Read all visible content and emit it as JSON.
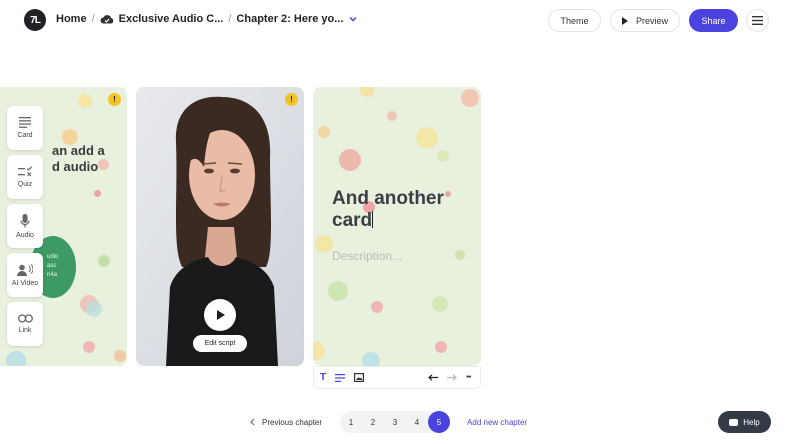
{
  "header": {
    "logo_text": "7L",
    "breadcrumbs": [
      "Home",
      "Exclusive Audio C...",
      "Chapter 2: Here yo..."
    ],
    "theme_label": "Theme",
    "preview_label": "Preview",
    "share_label": "Share",
    "accent_color": "#4a43e0"
  },
  "tools": [
    {
      "label": "Card",
      "icon": "card-icon"
    },
    {
      "label": "Quiz",
      "icon": "quiz-icon"
    },
    {
      "label": "Audio",
      "icon": "microphone-icon"
    },
    {
      "label": "AI Video",
      "icon": "ai-video-icon"
    },
    {
      "label": "Link",
      "icon": "link-icon"
    }
  ],
  "cards": {
    "card1": {
      "title_line1": "an add a",
      "title_line2": "d audio",
      "file_line1": "udio",
      "file_line2": "asc",
      "file_line3": "n4a",
      "warning": "!"
    },
    "card2": {
      "edit_script_label": "Edit script",
      "warning": "!"
    },
    "card3": {
      "title_line1": "And another",
      "title_line2": "card",
      "description_placeholder": "Description..."
    }
  },
  "card_toolbar": {
    "text_tool": "T",
    "more": "•••"
  },
  "pager": {
    "previous_label": "Previous chapter",
    "pages": [
      "1",
      "2",
      "3",
      "4",
      "5"
    ],
    "active_page": "5",
    "add_label": "Add new chapter"
  },
  "help_label": "Help"
}
